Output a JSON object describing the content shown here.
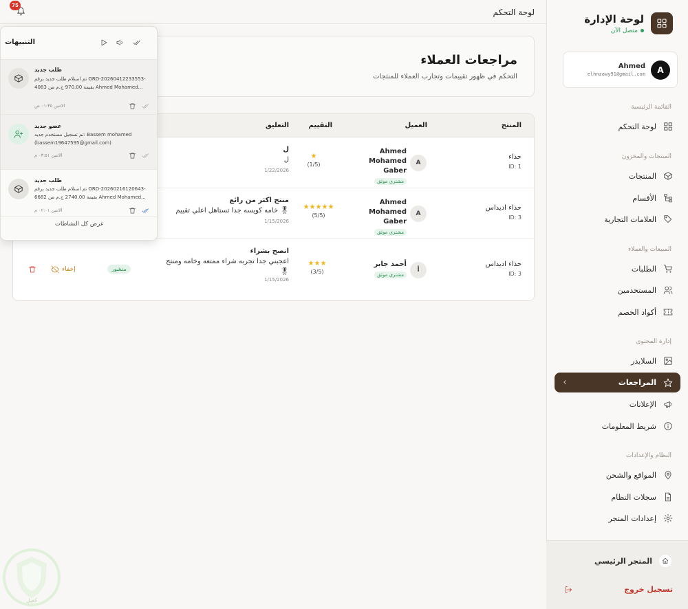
{
  "topbar": {
    "title": "لوحة التحكم",
    "notifications_count": "75"
  },
  "brand": {
    "title": "لوحة الإدارة",
    "status": "متصل الآن"
  },
  "user": {
    "name": "Ahmed",
    "email": "elhnzawy91@gmail.com",
    "avatar_letter": "A"
  },
  "sidebar": {
    "sections": {
      "main": "القائمة الرئيسية",
      "products": "المنتجات والمخزون",
      "sales": "المبيعات والعملاء",
      "content": "إدارة المحتوى",
      "system": "النظام والإعدادات"
    },
    "items": {
      "dashboard": "لوحة التحكم",
      "products": "المنتجات",
      "categories": "الأقسام",
      "brands": "العلامات التجارية",
      "orders": "الطلبات",
      "users": "المستخدمين",
      "coupons": "أكواد الخصم",
      "slider": "السلايدر",
      "reviews": "المراجعات",
      "ads": "الإعلانات",
      "infobar": "شريط المعلومات",
      "shipping": "المواقع والشحن",
      "logs": "سجلات النظام",
      "settings": "إعدادات المتجر"
    },
    "active": "reviews",
    "store_link": "المتجر الرئيسي",
    "logout": "تسجيل خروج"
  },
  "page": {
    "title": "مراجعات العملاء",
    "subtitle": "التحكم في ظهور تقييمات وتجارب العملاء للمنتجات"
  },
  "table": {
    "headers": {
      "product": "المنتج",
      "customer": "العميل",
      "rating": "التقييم",
      "comment": "التعليق"
    },
    "rows": [
      {
        "product": "حذاء",
        "product_id": "ID: 1",
        "avatar": "A",
        "customer": "Ahmed Mohamed Gaber",
        "verified": "مشتري موثق",
        "stars": "★",
        "rating": "(1/5)",
        "comment_title": "ل",
        "comment_body": "ل",
        "date": "1/22/2026"
      },
      {
        "product": "حذاء اديداس",
        "product_id": "ID: 3",
        "avatar": "A",
        "customer": "Ahmed Mohamed Gaber",
        "verified": "مشتري موثق",
        "stars": "★★★★★",
        "rating": "(5/5)",
        "comment_title": "منتج اكثر من رائع",
        "comment_body": "خامه كويسه جدا تستاهل اعلي تقييم 🎖",
        "date": "1/15/2026"
      },
      {
        "product": "حذاء اديداس",
        "product_id": "ID: 3",
        "avatar": "أ",
        "customer": "أحمد جابر",
        "verified": "مشتري موثق",
        "stars": "★★★",
        "rating": "(3/5)",
        "comment_title": "انصح بشراء",
        "comment_body": "اعجبني جدا تجربه شراء ممتعه وخامه ومنتج",
        "comment_emoji": "🎖",
        "date": "1/15/2026",
        "status": "منشور",
        "hide_label": "إخفاء"
      }
    ]
  },
  "notifications": {
    "title": "التنبيهات",
    "footer": "عرض كل النشاطات",
    "items": [
      {
        "type": "order",
        "title": "طلب جديد",
        "body": "تم استلام طلب جديد برقم ORD-20260412233553-4083 بقيمة 970.00 ج.م من Ahmed Mohamed...",
        "time": "الاثنين ٠١:٣٥ ص"
      },
      {
        "type": "member",
        "title": "عضو جديد",
        "body": "تم تسجيل مستخدم جديد: Bassem mohamed (bassem19647595@gmail.com)",
        "time": "الاثنين ٠٣:٥١ م"
      },
      {
        "type": "order",
        "title": "طلب جديد",
        "body": "تم استلام طلب جديد برقم ORD-20260216120643-6682 بقيمة 2740.00 ج.م من Ahmed Mohamed...",
        "time": "الاثنين ٠٢:٠١ م"
      }
    ]
  },
  "watermark": {
    "text": "كفيل"
  },
  "colors": {
    "accent": "#4a3626",
    "star": "#f0b51c",
    "success": "#2e8f55",
    "danger": "#d9342b",
    "warning": "#c77d1a"
  }
}
